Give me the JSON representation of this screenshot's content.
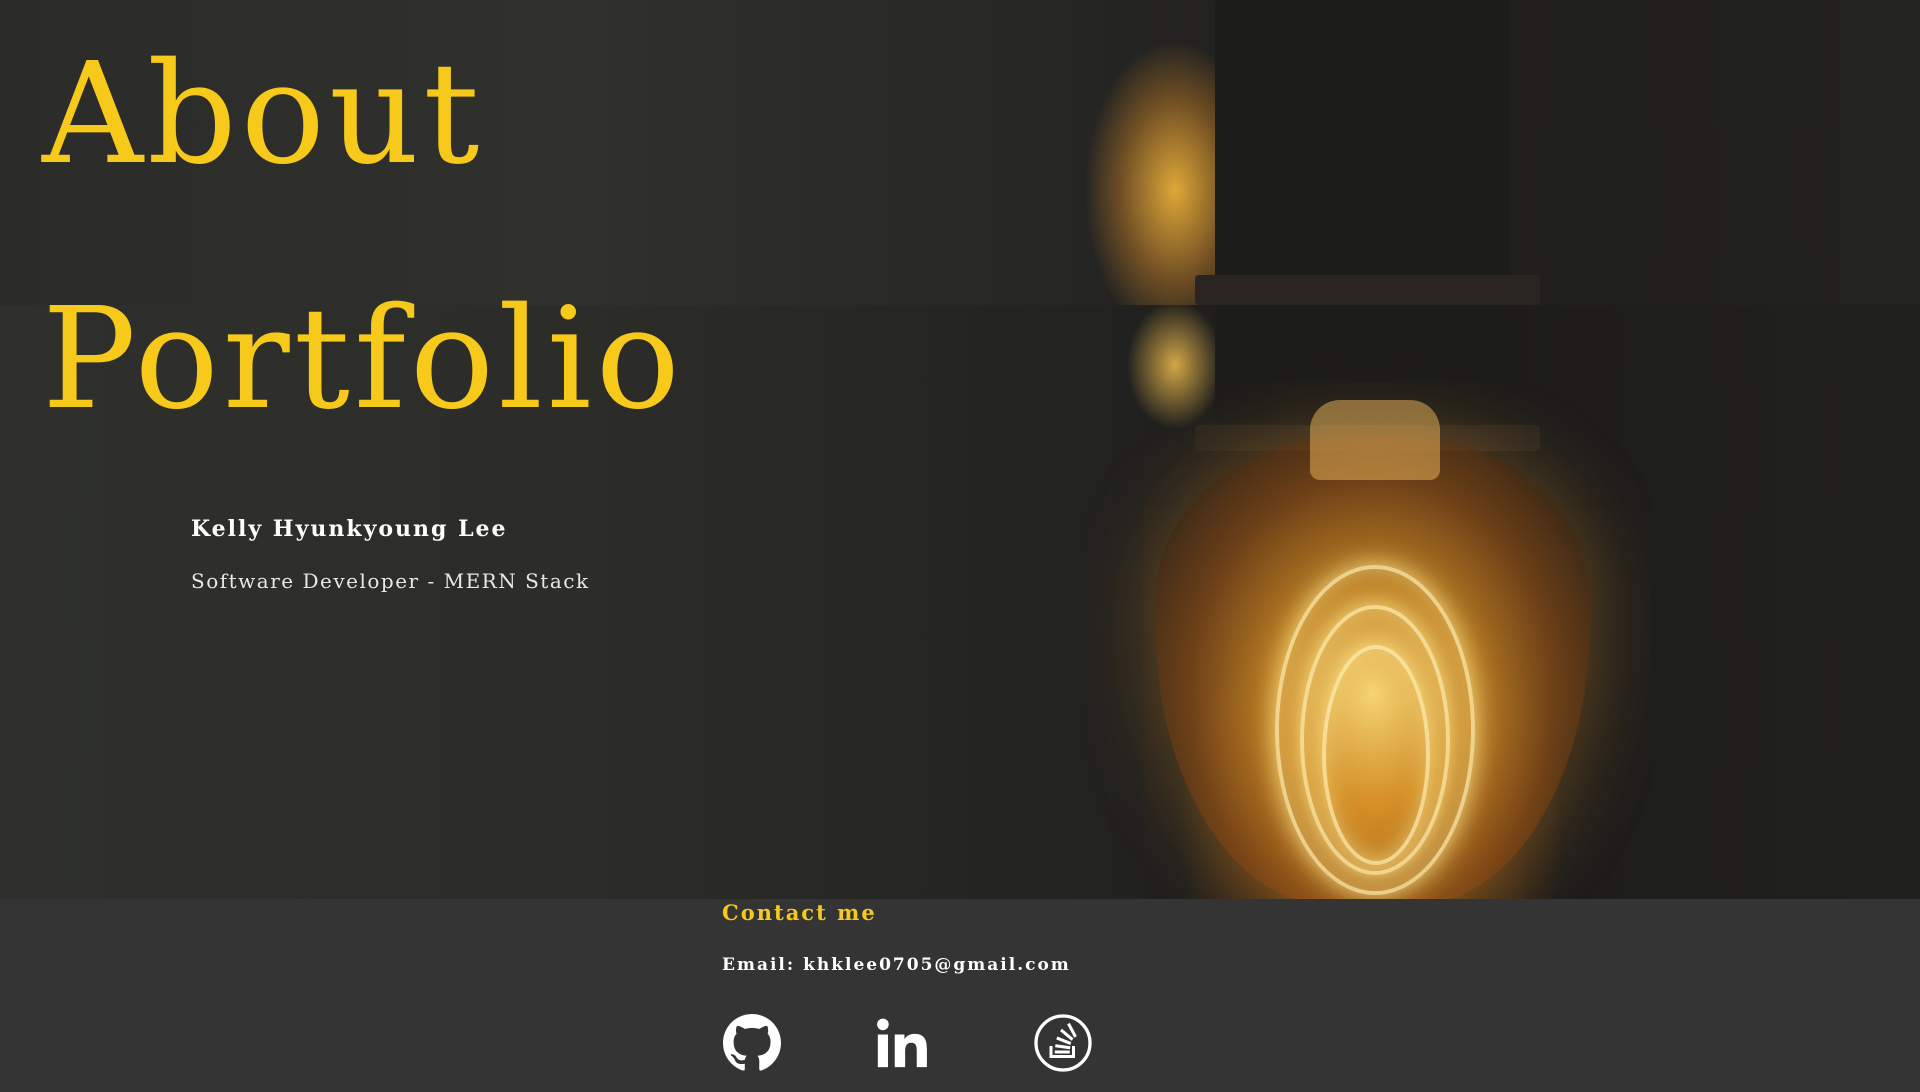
{
  "hero": {
    "title_line1": "About",
    "title_line2": "Portfolio",
    "name": "Kelly Hyunkyoung Lee",
    "role": "Software Developer - MERN Stack"
  },
  "contact": {
    "heading": "Contact me",
    "email": "Email: khklee0705@gmail.com",
    "links": [
      {
        "icon": "github-icon"
      },
      {
        "icon": "linkedin-icon"
      },
      {
        "icon": "stackoverflow-icon"
      }
    ]
  },
  "colors": {
    "accent": "#f6c91b",
    "background": "#343434",
    "text": "#ffffff"
  }
}
